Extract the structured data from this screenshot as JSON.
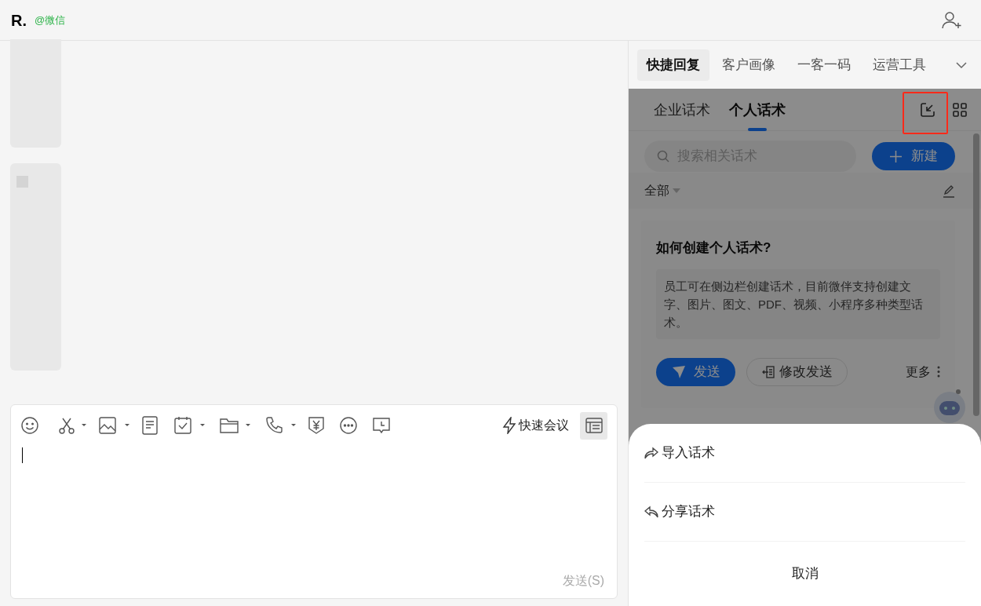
{
  "header": {
    "name": "R.",
    "source": "@微信"
  },
  "composer": {
    "quick_meeting": "快速会议",
    "panel_toggle_on": true,
    "send": "发送(S)"
  },
  "sidebar": {
    "tabs": [
      {
        "label": "快捷回复",
        "selected": true
      },
      {
        "label": "客户画像",
        "selected": false
      },
      {
        "label": "一客一码",
        "selected": false
      },
      {
        "label": "运营工具",
        "selected": false
      }
    ],
    "sub_tabs": [
      {
        "label": "企业话术",
        "selected": false
      },
      {
        "label": "个人话术",
        "selected": true
      }
    ],
    "search": {
      "placeholder": "搜索相关话术"
    },
    "new_button": "新建",
    "filter": "全部",
    "card": {
      "title": "如何创建个人话术?",
      "body": "员工可在侧边栏创建话术，目前微伴支持创建文字、图片、图文、PDF、视频、小程序多种类型话术。",
      "send_button": "发送",
      "edit_send_button": "修改发送",
      "more": "更多"
    },
    "sheet": {
      "items": [
        {
          "kind": "import",
          "label": "导入话术"
        },
        {
          "kind": "share",
          "label": "分享话术"
        }
      ],
      "cancel": "取消"
    }
  }
}
